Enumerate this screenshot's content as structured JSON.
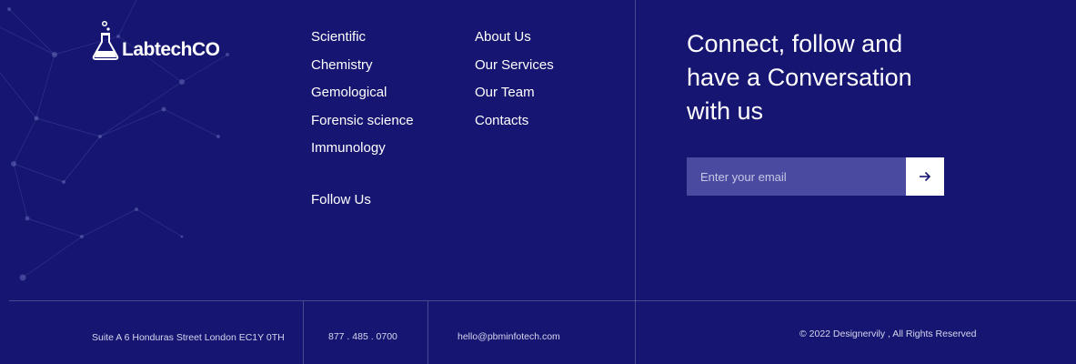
{
  "brand": {
    "name": "LabtechCO",
    "logo_icon": "flask-icon"
  },
  "nav_columns": {
    "science": [
      "Scientific",
      "Chemistry",
      "Gemological",
      "Forensic science",
      "Immunology"
    ],
    "company": [
      "About Us",
      "Our Services",
      "Our Team",
      "Contacts"
    ]
  },
  "follow": {
    "label": "Follow Us"
  },
  "newsletter": {
    "headline": "Connect, follow and have a Conversation with us",
    "email_placeholder": "Enter your email",
    "submit_icon": "arrow-right-icon"
  },
  "bottom_bar": {
    "address": "Suite A 6 Honduras Street London EC1Y 0TH",
    "phone": "877 . 485 . 0700",
    "email": "hello@pbminfotech.com",
    "copyright": "© 2022 Designervily , All Rights Reserved"
  },
  "colors": {
    "background": "#161672",
    "input_background": "#4a4aa0",
    "text": "#ffffff"
  }
}
